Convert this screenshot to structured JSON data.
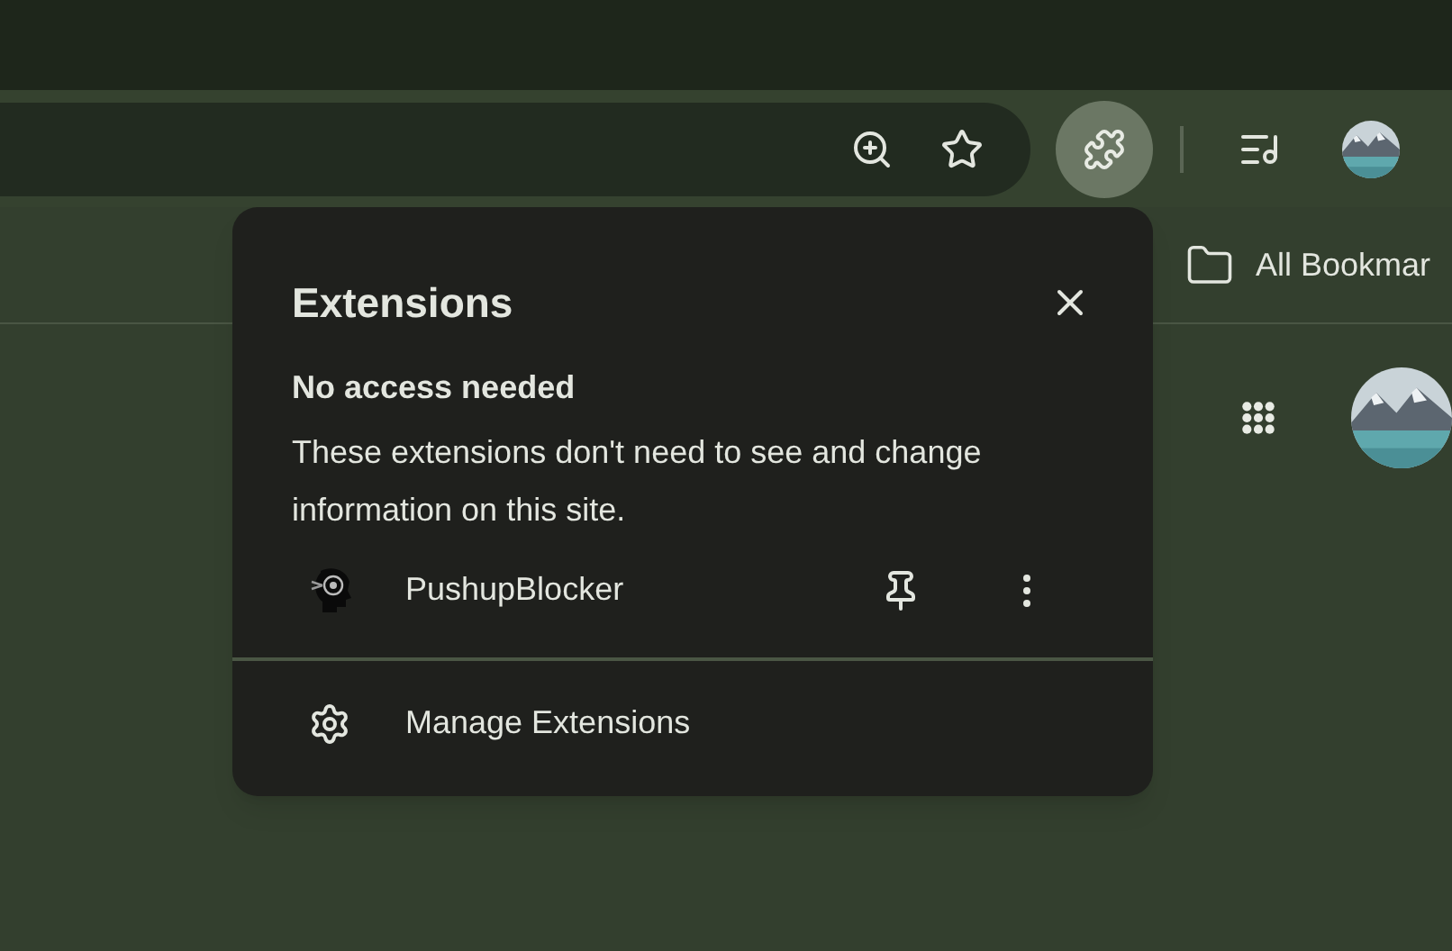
{
  "bookmarks_bar": {
    "items": [
      {
        "label": "All Bookmar"
      }
    ]
  },
  "extensions_popup": {
    "title": "Extensions",
    "section_heading": "No access needed",
    "description": "These extensions don't need to see and change information on this site.",
    "extensions": [
      {
        "name": "PushupBlocker",
        "pinned": false
      }
    ],
    "footer_label": "Manage Extensions"
  }
}
